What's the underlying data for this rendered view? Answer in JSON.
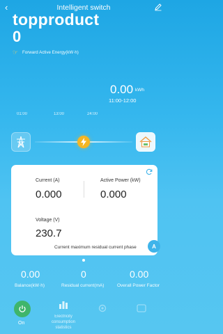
{
  "header": {
    "title": "Intelligent switch",
    "back_icon": "chevron-left-icon",
    "edit_icon": "pencil-icon"
  },
  "brand": "topproduct",
  "energy": {
    "value": "0",
    "label": "Forward Active Energy(kW·h)",
    "icon": "hand-icon"
  },
  "period": {
    "value": "0.00",
    "unit": "kWh",
    "range": "11:00-12:00"
  },
  "ticks": [
    "01:00",
    "13:00",
    "24:00"
  ],
  "flow": {
    "left_icon": "tower-icon",
    "center_icon": "bolt-icon",
    "right_icon": "home-icon"
  },
  "card": {
    "current_label": "Current (A)",
    "current_value": "0.000",
    "power_label": "Active Power (kW)",
    "power_value": "0.000",
    "voltage_label": "Voltage (V)",
    "voltage_value": "230.7",
    "phase_text": "Current maximum residual current phase",
    "phase_badge": "A"
  },
  "stats": [
    {
      "value": "0.00",
      "label": "Balance(kW·h)"
    },
    {
      "value": "0",
      "label": "Residual current(mA)"
    },
    {
      "value": "0.00",
      "label": "Overall Power Factor"
    }
  ],
  "tabs": {
    "on_label": "On",
    "elec_label": "Electricity consumption statistics"
  },
  "colors": {
    "accent": "#3fb4ea",
    "bolt": "#f5b623",
    "power_on": "#3fb56b"
  }
}
